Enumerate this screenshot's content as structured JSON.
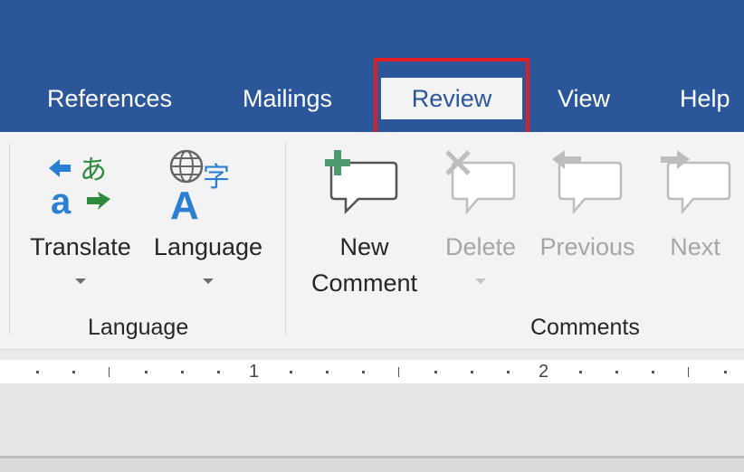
{
  "tabs": [
    {
      "label": "References"
    },
    {
      "label": "Mailings"
    },
    {
      "label": "Review"
    },
    {
      "label": "View"
    },
    {
      "label": "Help"
    }
  ],
  "active_tab": "Review",
  "groups": {
    "language": {
      "label": "Language",
      "buttons": {
        "translate": {
          "label": "Translate",
          "icon": "translate-icon"
        },
        "language": {
          "label": "Language",
          "icon": "language-icon"
        }
      }
    },
    "comments": {
      "label": "Comments",
      "buttons": {
        "new_comment": {
          "line1": "New",
          "line2": "Comment",
          "icon": "new-comment-icon"
        },
        "delete": {
          "label": "Delete",
          "icon": "delete-comment-icon",
          "enabled": false
        },
        "previous": {
          "label": "Previous",
          "icon": "previous-comment-icon",
          "enabled": false
        },
        "next": {
          "label": "Next",
          "icon": "next-comment-icon",
          "enabled": false
        }
      }
    }
  },
  "ruler": {
    "numbers": [
      "1",
      "2"
    ]
  },
  "colors": {
    "brand_blue": "#2b579a",
    "highlight_red": "#e01e24",
    "translate_blue": "#2a7fd4",
    "translate_green": "#2e8b3e",
    "comment_plus_green": "#4e9a6e",
    "disabled_gray": "#a6a6a6"
  }
}
